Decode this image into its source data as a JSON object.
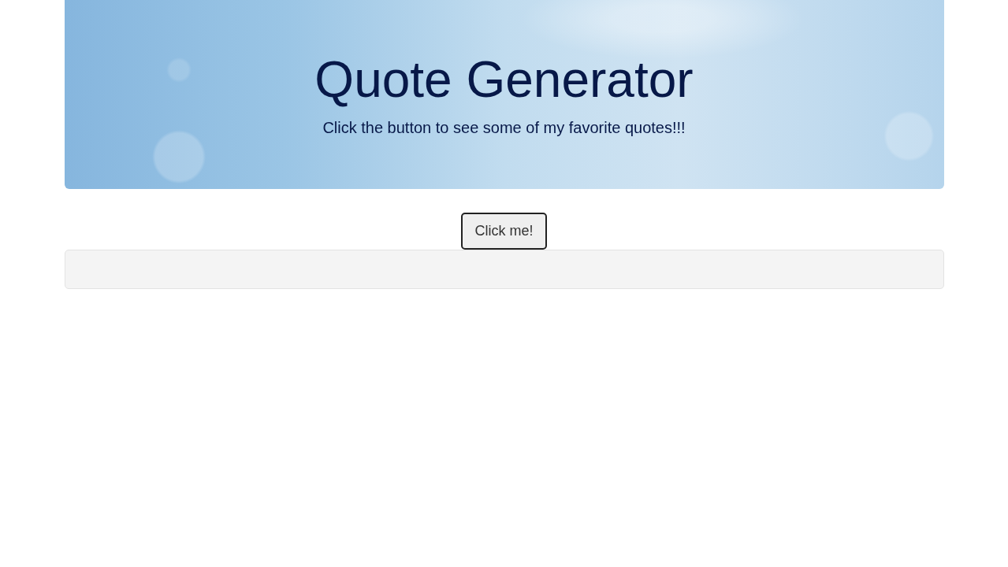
{
  "header": {
    "title": "Quote Generator",
    "subtitle": "Click the button to see some of my favorite quotes!!!"
  },
  "button": {
    "label": "Click me!"
  }
}
